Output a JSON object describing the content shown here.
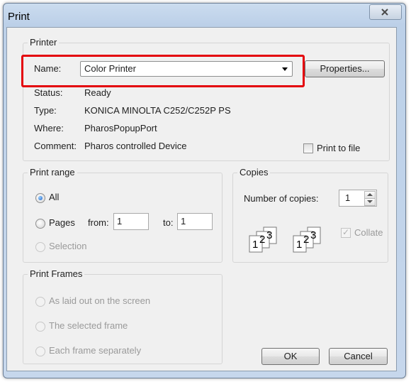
{
  "window": {
    "title": "Print"
  },
  "printer": {
    "group_label": "Printer",
    "name_label": "Name:",
    "name_value": "Color Printer",
    "properties_label": "Properties...",
    "status_label": "Status:",
    "status_value": "Ready",
    "type_label": "Type:",
    "type_value": "KONICA MINOLTA C252/C252P PS",
    "where_label": "Where:",
    "where_value": "PharosPopupPort",
    "comment_label": "Comment:",
    "comment_value": "Pharos controlled Device",
    "print_to_file_label": "Print to file",
    "print_to_file_checked": false
  },
  "print_range": {
    "group_label": "Print range",
    "all_label": "All",
    "pages_label": "Pages",
    "from_label": "from:",
    "from_value": "1",
    "to_label": "to:",
    "to_value": "1",
    "selection_label": "Selection",
    "selected": "All"
  },
  "copies": {
    "group_label": "Copies",
    "number_label": "Number of copies:",
    "number_value": "1",
    "collate_label": "Collate",
    "collate_checked": true,
    "collate_icon": {
      "page1": "1",
      "page2": "2",
      "page3": "3"
    }
  },
  "print_frames": {
    "group_label": "Print Frames",
    "option1": "As laid out on the screen",
    "option2": "The selected frame",
    "option3": "Each frame separately"
  },
  "buttons": {
    "ok": "OK",
    "cancel": "Cancel"
  },
  "colors": {
    "highlight": "#e4040c",
    "title_bar": "#bcd0e8",
    "dialog_bg": "#f0f0f0",
    "disabled_text": "#9a9a9a"
  }
}
